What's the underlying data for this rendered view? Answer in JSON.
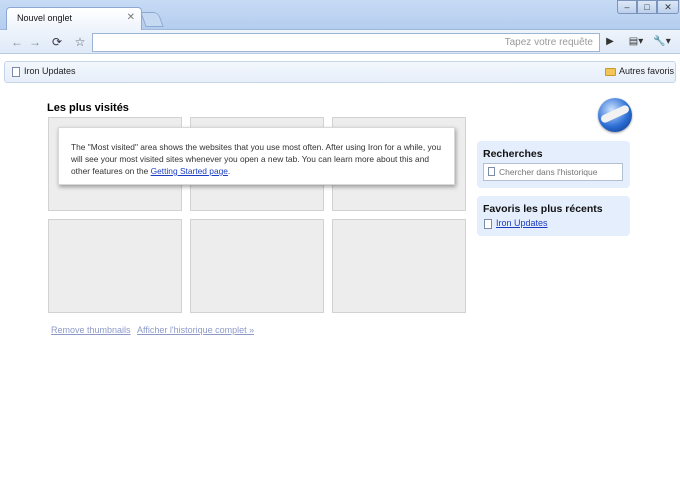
{
  "tab": {
    "title": "Nouvel onglet"
  },
  "omnibox": {
    "placeholder": "Tapez votre requête"
  },
  "bookmarks_bar": {
    "items": [
      {
        "label": "Iron Updates"
      }
    ],
    "other": "Autres favoris"
  },
  "most_visited": {
    "title": "Les plus visités",
    "notice_text": "The \"Most visited\" area shows the websites that you use most often. After using Iron for a while, you will see your most visited sites whenever you open a new tab. You can learn more about this and other features on the ",
    "notice_link": "Getting Started page",
    "notice_end": ".",
    "remove_thumbnails": "Remove thumbnails",
    "history": "Afficher l'historique complet »"
  },
  "searches": {
    "title": "Recherches",
    "placeholder": "Chercher dans l'historique"
  },
  "recent_bookmarks": {
    "title": "Favoris les plus récents",
    "items": [
      {
        "label": "Iron Updates"
      }
    ]
  },
  "colors": {
    "frame": "#b4cdef",
    "panel": "#e5eefc",
    "link": "#1a3dc1"
  }
}
